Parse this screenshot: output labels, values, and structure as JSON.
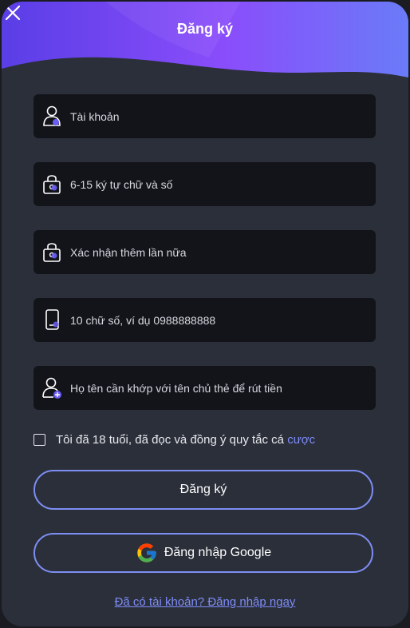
{
  "header": {
    "title": "Đăng ký",
    "close_icon": "close-icon",
    "gradient_colors": [
      "#5a3ee6",
      "#8a4dfb",
      "#6a7bf8"
    ]
  },
  "form": {
    "fields": [
      {
        "name": "username",
        "icon": "user-icon",
        "placeholder": "Tài khoản"
      },
      {
        "name": "password",
        "icon": "lock-icon",
        "placeholder": "6-15 ký tự chữ và số"
      },
      {
        "name": "confirm-password",
        "icon": "lock-icon",
        "placeholder": "Xác nhận thêm lần nữa"
      },
      {
        "name": "phone",
        "icon": "phone-icon",
        "placeholder": "10 chữ số, ví dụ 0988888888"
      },
      {
        "name": "full-name",
        "icon": "add-user-icon",
        "placeholder": "Họ tên cần khớp với tên chủ thẻ để rút tiền"
      }
    ],
    "agreement": {
      "text": "Tôi đã 18 tuổi, đã đọc và đồng ý quy tắc cá",
      "link_text": "cược",
      "checked": false
    },
    "register_button": "Đăng ký",
    "google_button": "Đăng nhập Google",
    "login_link": "Đã có tài khoản? Đăng nhập ngay"
  },
  "colors": {
    "accent": "#7e8cf7",
    "modal_bg": "#2b2f3a",
    "field_bg": "#12141a"
  }
}
